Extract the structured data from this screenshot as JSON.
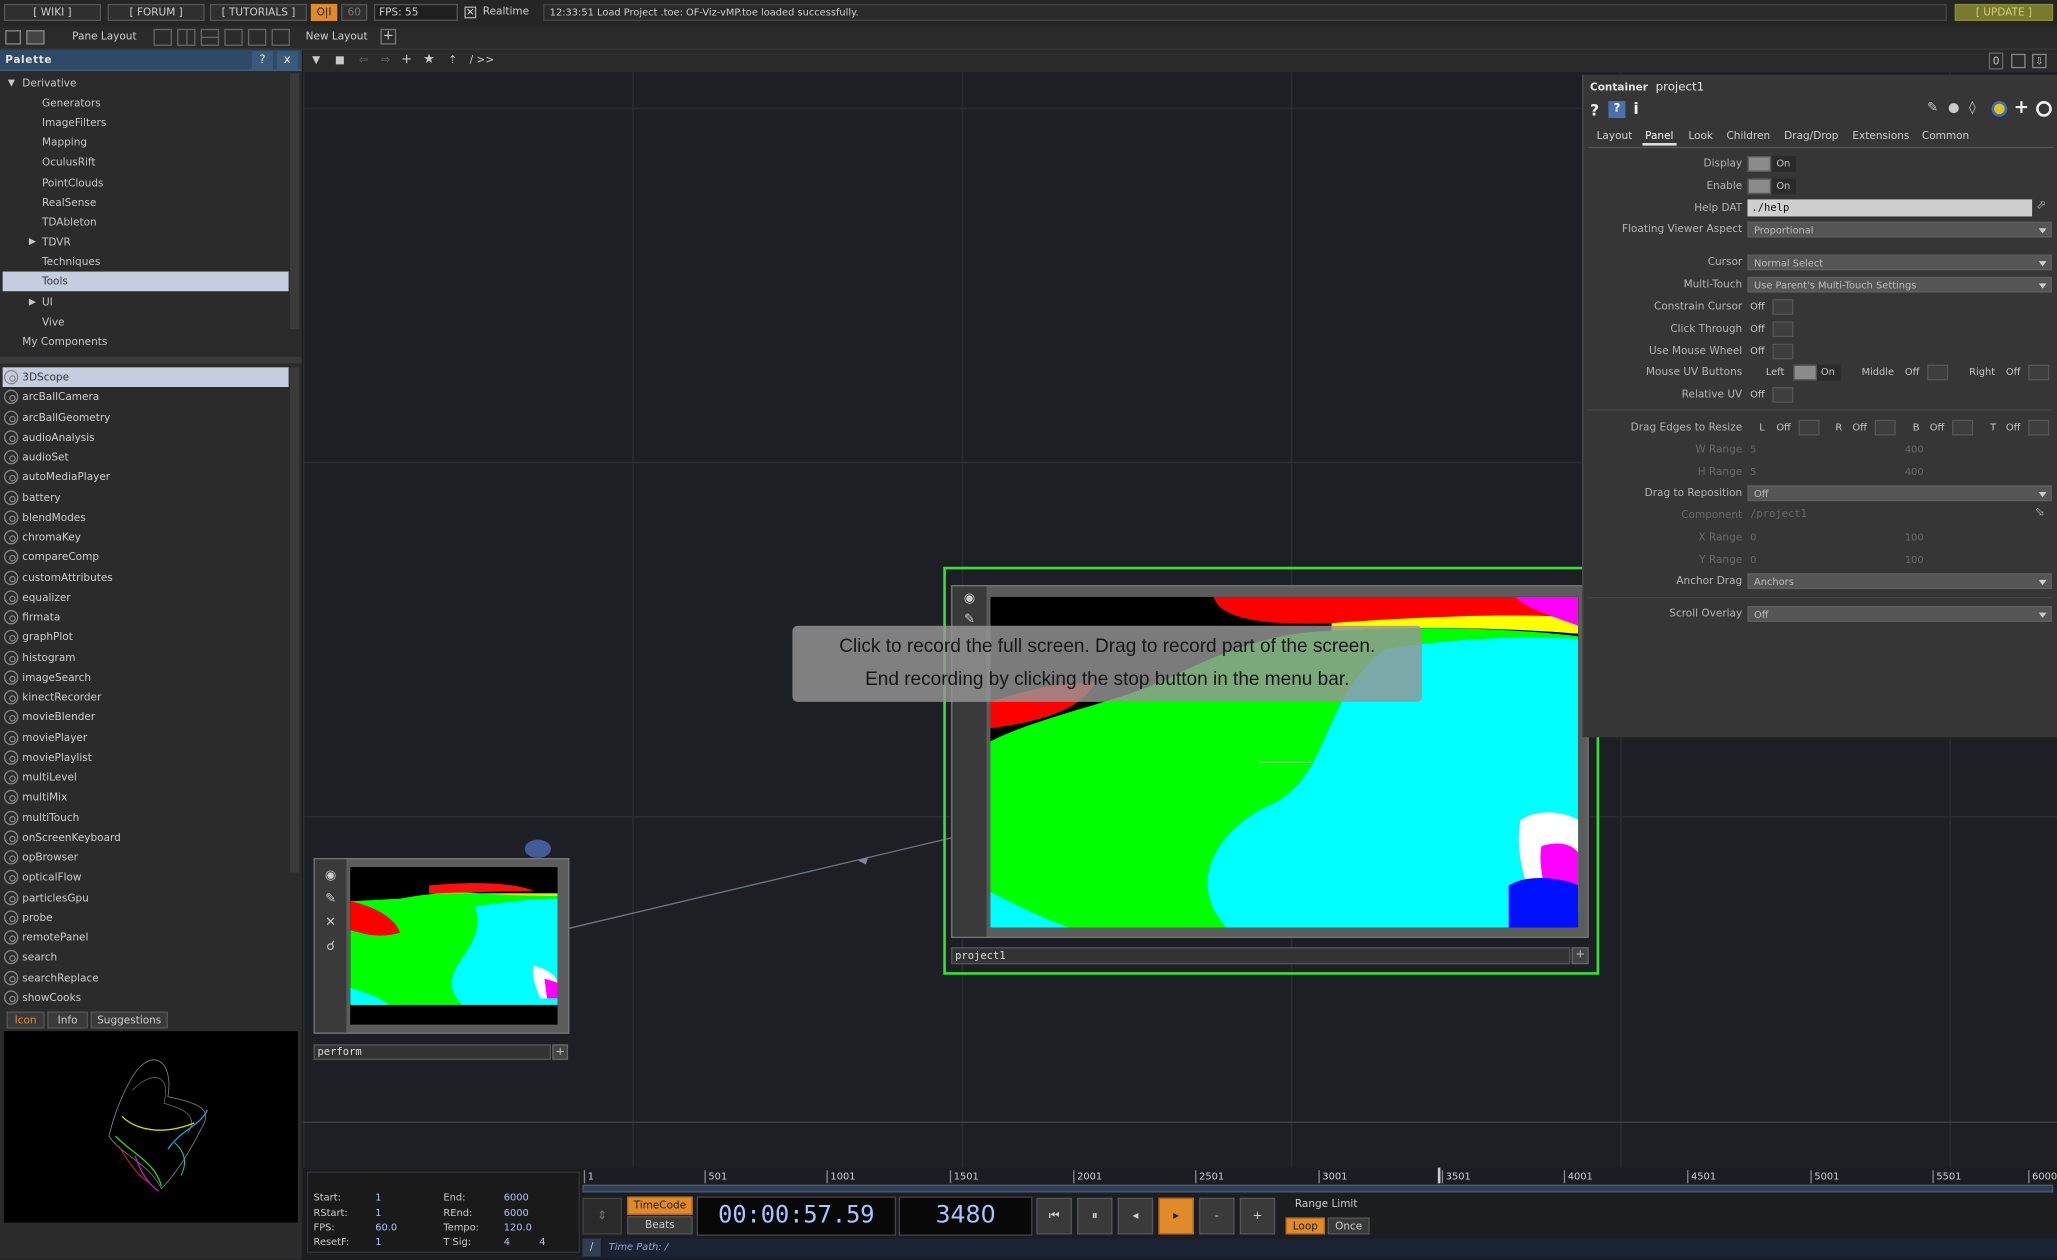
{
  "topbar": {
    "wiki": "[ WIKI ]",
    "forum": "[ FORUM ]",
    "tutorials": "[ TUTORIALS ]",
    "oi": "O|I",
    "sixty": "60",
    "fps": "FPS:  55",
    "realtime": "Realtime",
    "status": "12:33:51 Load Project .toe: OF-Viz-vMP.toe loaded successfully.",
    "update": "[ UPDATE ]"
  },
  "secondbar": {
    "pane_layout": "Pane Layout",
    "new_layout": "New Layout",
    "path": "/ >>",
    "counter": "0"
  },
  "palette": {
    "title": "Palette",
    "help": "?",
    "close": "x",
    "folders": [
      {
        "label": "Derivative"
      },
      {
        "label": "Generators"
      },
      {
        "label": "ImageFilters"
      },
      {
        "label": "Mapping"
      },
      {
        "label": "OculusRift"
      },
      {
        "label": "PointClouds"
      },
      {
        "label": "RealSense"
      },
      {
        "label": "TDAbleton"
      },
      {
        "label": "TDVR"
      },
      {
        "label": "Techniques"
      },
      {
        "label": "Tools"
      },
      {
        "label": "UI"
      },
      {
        "label": "Vive"
      },
      {
        "label": "My Components"
      }
    ],
    "components": [
      "3DScope",
      "arcBallCamera",
      "arcBallGeometry",
      "audioAnalysis",
      "audioSet",
      "autoMediaPlayer",
      "battery",
      "blendModes",
      "chromaKey",
      "compareComp",
      "customAttributes",
      "equalizer",
      "firmata",
      "graphPlot",
      "histogram",
      "imageSearch",
      "kinectRecorder",
      "movieBlender",
      "moviePlayer",
      "moviePlaylist",
      "multiLevel",
      "multiMix",
      "multiTouch",
      "onScreenKeyboard",
      "opBrowser",
      "opticalFlow",
      "particlesGpu",
      "probe",
      "remotePanel",
      "search",
      "searchReplace",
      "showCooks"
    ],
    "tabs": {
      "icon": "Icon",
      "info": "Info",
      "suggestions": "Suggestions"
    }
  },
  "nodes": {
    "perform": "perform",
    "project1": "project1"
  },
  "overlay": {
    "line1": "Click to record the full screen. Drag to record part of the screen.",
    "line2": "End recording by clicking the stop button in the menu bar."
  },
  "params": {
    "type": "Container",
    "name": "project1",
    "tabs": [
      "Layout",
      "Panel",
      "Look",
      "Children",
      "Drag/Drop",
      "Extensions",
      "Common"
    ],
    "display": {
      "label": "Display",
      "value": "On"
    },
    "enable": {
      "label": "Enable",
      "value": "On"
    },
    "helpdat": {
      "label": "Help DAT",
      "value": "./help"
    },
    "floating": {
      "label": "Floating Viewer Aspect",
      "value": "Proportional"
    },
    "cursor": {
      "label": "Cursor",
      "value": "Normal Select"
    },
    "multitouch": {
      "label": "Multi-Touch",
      "value": "Use Parent's Multi-Touch Settings"
    },
    "constrain": {
      "label": "Constrain Cursor",
      "value": "Off"
    },
    "clickthrough": {
      "label": "Click Through",
      "value": "Off"
    },
    "mousewheel": {
      "label": "Use Mouse Wheel",
      "value": "Off"
    },
    "uvbuttons": {
      "label": "Mouse UV Buttons",
      "left": "Left",
      "left_val": "On",
      "middle": "Middle",
      "middle_val": "Off",
      "right": "Right",
      "right_val": "Off"
    },
    "relativeuv": {
      "label": "Relative UV",
      "value": "Off"
    },
    "dragedges": {
      "label": "Drag Edges to Resize",
      "l": "L",
      "r": "R",
      "b": "B",
      "t": "T",
      "off": "Off"
    },
    "wrange": {
      "label": "W Range",
      "min": "5",
      "max": "400"
    },
    "hrange": {
      "label": "H Range",
      "min": "5",
      "max": "400"
    },
    "reposition": {
      "label": "Drag to Reposition",
      "value": "Off"
    },
    "component": {
      "label": "Component",
      "value": "/project1"
    },
    "xrange": {
      "label": "X Range",
      "min": "0",
      "max": "100"
    },
    "yrange": {
      "label": "Y Range",
      "min": "0",
      "max": "100"
    },
    "anchordrag": {
      "label": "Anchor Drag",
      "value": "Anchors"
    },
    "scrolloverlay": {
      "label": "Scroll Overlay",
      "value": "Off"
    }
  },
  "timeline": {
    "ticks": [
      "1",
      "501",
      "1001",
      "1501",
      "2001",
      "2501",
      "3001",
      "3501",
      "4001",
      "4501",
      "5001",
      "5501",
      "6000"
    ],
    "start_l": "Start:",
    "start_v": "1",
    "rstart_l": "RStart:",
    "rstart_v": "1",
    "fps_l": "FPS:",
    "fps_v": "60.0",
    "resetf_l": "ResetF:",
    "resetf_v": "1",
    "end_l": "End:",
    "end_v": "6000",
    "rend_l": "REnd:",
    "rend_v": "6000",
    "tempo_l": "Tempo:",
    "tempo_v": "120.0",
    "tsig_l": "T Sig:",
    "tsig_a": "4",
    "tsig_b": "4",
    "timecode": "TimeCode",
    "beats": "Beats",
    "time": "00:00:57.59",
    "frame": "3480",
    "minus": "-",
    "plus": "+",
    "range_limit": "Range Limit",
    "loop": "Loop",
    "once": "Once",
    "time_path": "Time Path: /",
    "slash": "/"
  },
  "colors": {
    "accent": "#e08a2a",
    "select": "#33e233",
    "panel": "#3a3a3a"
  }
}
